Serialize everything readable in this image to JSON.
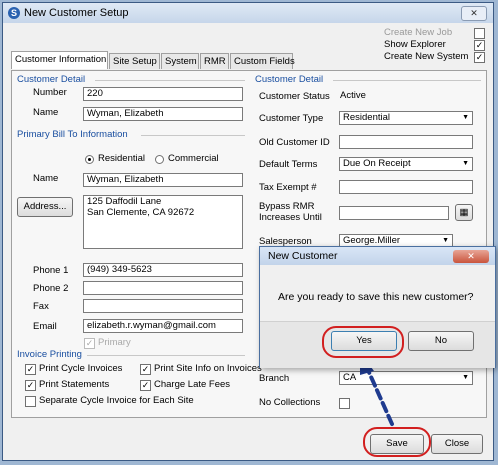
{
  "window": {
    "title": "New Customer Setup",
    "close": "✕"
  },
  "top_options": [
    {
      "label": "Create New Job",
      "checked": false,
      "disabled": true
    },
    {
      "label": "Show Explorer",
      "checked": true,
      "disabled": false
    },
    {
      "label": "Create New System",
      "checked": true,
      "disabled": false
    }
  ],
  "tabs": [
    "Customer Information",
    "Site Setup",
    "System",
    "RMR",
    "Custom Fields"
  ],
  "customer_detail_left": {
    "header": "Customer Detail",
    "number_label": "Number",
    "number_value": "220",
    "name_label": "Name",
    "name_value": "Wyman, Elizabeth"
  },
  "bill_to": {
    "header": "Primary Bill To Information",
    "residential": "Residential",
    "commercial": "Commercial",
    "name_label": "Name",
    "name_value": "Wyman, Elizabeth",
    "address_button": "Address...",
    "address_line1": "125 Daffodil Lane",
    "address_line2": "San Clemente, CA  92672",
    "phone1_label": "Phone 1",
    "phone1_value": "(949) 349-5623",
    "phone2_label": "Phone 2",
    "fax_label": "Fax",
    "email_label": "Email",
    "email_value": "elizabeth.r.wyman@gmail.com",
    "primary": "Primary"
  },
  "invoice": {
    "header": "Invoice Printing",
    "print_cycle": "Print Cycle Invoices",
    "print_site": "Print Site Info on Invoices",
    "print_statements": "Print Statements",
    "charge_late": "Charge Late Fees",
    "separate_cycle": "Separate Cycle Invoice for Each Site"
  },
  "customer_detail_right": {
    "header": "Customer Detail",
    "status_label": "Customer Status",
    "status_value": "Active",
    "type_label": "Customer Type",
    "type_value": "Residential",
    "old_id_label": "Old Customer ID",
    "terms_label": "Default Terms",
    "terms_value": "Due On Receipt",
    "tax_label": "Tax Exempt #",
    "bypass_label1": "Bypass RMR",
    "bypass_label2": "Increases Until",
    "sales_label": "Salesperson",
    "sales_value": "George.Miller",
    "branch_label": "Branch",
    "branch_value": "CA",
    "collections_label": "No Collections"
  },
  "footer": {
    "save": "Save",
    "close": "Close"
  },
  "dialog": {
    "title": "New Customer",
    "message": "Are you ready to save this new customer?",
    "yes": "Yes",
    "no": "No",
    "close": "✕"
  },
  "colors": {
    "annotation_ring": "#d21f1f",
    "annotation_arrow": "#1f3b8f",
    "section_header": "#1a4fa0"
  }
}
